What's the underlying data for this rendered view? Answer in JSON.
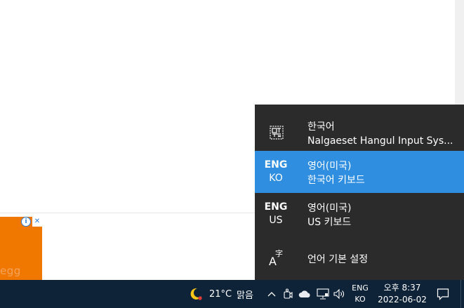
{
  "ad": {
    "brand": "egg",
    "info_glyph": "i",
    "close_glyph": "✕"
  },
  "ime_menu": {
    "items": [
      {
        "short_top": "",
        "short_bottom": "",
        "icon": "hangul-ime-icon",
        "name": "한국어",
        "subtitle": "Nalgaeset Hangul Input Sys...",
        "selected": false
      },
      {
        "short_top": "ENG",
        "short_bottom": "KO",
        "name": "영어(미국)",
        "subtitle": "한국어 키보드",
        "selected": true
      },
      {
        "short_top": "ENG",
        "short_bottom": "US",
        "name": "영어(미국)",
        "subtitle": "US 키보드",
        "selected": false
      }
    ],
    "settings": {
      "icon": "language-settings-icon",
      "glyph_a": "A",
      "glyph_z": "字",
      "label": "언어 기본 설정"
    },
    "colors": {
      "background": "#2b2b2b",
      "selected": "#2f8ee0"
    }
  },
  "taskbar": {
    "weather": {
      "icon": "moon-icon",
      "temperature": "21°C",
      "condition": "맑음"
    },
    "tray": {
      "chevron": "^",
      "icons": [
        "meet-now-icon",
        "onedrive-cloud-icon",
        "network-icon",
        "volume-icon"
      ]
    },
    "language": {
      "top": "ENG",
      "bottom": "KO"
    },
    "clock": {
      "time": "오후 8:37",
      "date": "2022-06-02"
    },
    "notification_icon": "notification-icon",
    "colors": {
      "background": "#0f2338"
    }
  }
}
